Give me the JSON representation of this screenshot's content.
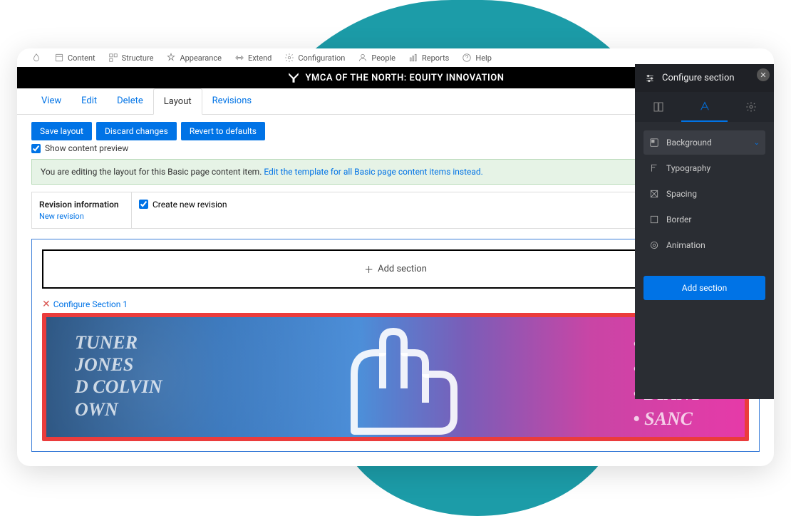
{
  "toolbar": {
    "items": [
      "Content",
      "Structure",
      "Appearance",
      "Extend",
      "Configuration",
      "People",
      "Reports",
      "Help"
    ]
  },
  "site_title": "YMCA OF THE NORTH: EQUITY INNOVATION",
  "tabs": {
    "view": "View",
    "edit": "Edit",
    "delete": "Delete",
    "layout": "Layout",
    "revisions": "Revisions"
  },
  "actions": {
    "save": "Save layout",
    "discard": "Discard changes",
    "revert": "Revert to defaults",
    "preview_label": "Show content preview"
  },
  "notice": {
    "text_prefix": "You are editing the layout for this Basic page content item. ",
    "link": "Edit the template for all Basic page content items instead."
  },
  "revision": {
    "heading": "Revision information",
    "link": "New revision",
    "checkbox_label": "Create new revision"
  },
  "layout": {
    "add_section": "Add section",
    "configure_link": "Configure Section 1"
  },
  "hero": {
    "left_names": "TUNER\nJONES\nD COLVIN\nOWN",
    "right_names": "• JAME\n• LINU\n• DIANT\n• SANC"
  },
  "panel": {
    "title": "Configure section",
    "props": {
      "background": "Background",
      "typography": "Typography",
      "spacing": "Spacing",
      "border": "Border",
      "animation": "Animation"
    },
    "add_button": "Add section"
  }
}
